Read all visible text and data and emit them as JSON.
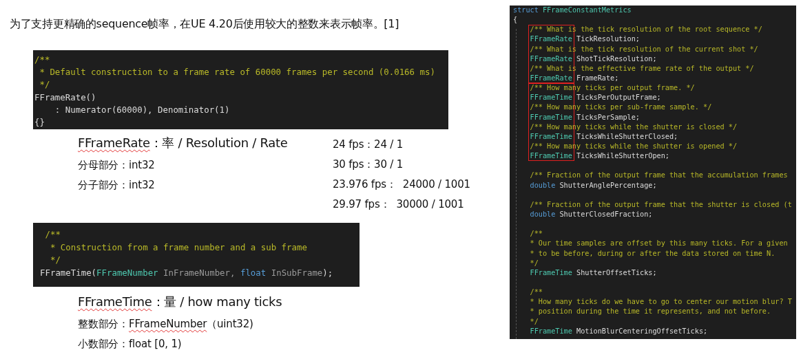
{
  "intro": "为了支持更精确的sequence帧率，在UE 4.20后使用较大的整数来表示帧率。[1]",
  "code_block_1": [
    [
      {
        "kind": "comment",
        "text": "/**"
      }
    ],
    [
      {
        "kind": "comment",
        "text": " * Default construction to a frame rate of 60000 frames per second (0.0166 ms)"
      }
    ],
    [
      {
        "kind": "comment",
        "text": " */"
      }
    ],
    [
      {
        "kind": "plain",
        "text": "FFrameRate()"
      }
    ],
    [
      {
        "kind": "plain",
        "text": "    : Numerator(60000), Denominator(1)"
      }
    ],
    [
      {
        "kind": "plain",
        "text": "{}"
      }
    ]
  ],
  "frame_rate": {
    "heading": [
      {
        "text": "FFrameRate",
        "misspelled": true
      },
      {
        "text": "：率 / Resolution / Rate",
        "misspelled": false
      }
    ],
    "details": [
      "分母部分：int32",
      "分子部分：int32"
    ]
  },
  "fps_examples": [
    "24 fps：24 / 1",
    "30 fps：30 / 1",
    "23.976 fps：  24000 / 1001",
    "29.97 fps：  30000 / 1001"
  ],
  "code_block_2": [
    [
      {
        "kind": "comment",
        "text": " /**"
      }
    ],
    [
      {
        "kind": "comment",
        "text": "  * Construction from a frame number and a sub frame"
      }
    ],
    [
      {
        "kind": "comment",
        "text": "  */"
      }
    ],
    [
      {
        "kind": "plain",
        "text": "FFrameTime("
      },
      {
        "kind": "type",
        "text": "FFrameNumber"
      },
      {
        "kind": "param",
        "text": " InFrameNumber, "
      },
      {
        "kind": "keyword",
        "text": "float"
      },
      {
        "kind": "param",
        "text": " InSubFrame"
      },
      {
        "kind": "plain",
        "text": ");"
      }
    ]
  ],
  "frame_time": {
    "heading": [
      {
        "text": "FFrameTime",
        "misspelled": true
      },
      {
        "text": "：量 / how many ticks",
        "misspelled": false
      }
    ],
    "details": [
      [
        {
          "text": "整数部分：",
          "misspelled": false
        },
        {
          "text": "FFrameNumber",
          "misspelled": true
        },
        {
          "text": "（uint32)",
          "misspelled": false
        }
      ],
      [
        {
          "text": "小数部分：float [0, 1)",
          "misspelled": false
        }
      ]
    ]
  },
  "struct_code": {
    "head": [
      [
        {
          "kind": "keyword",
          "text": "struct"
        },
        {
          "kind": "type",
          "text": " FFrameConstantMetrics"
        }
      ],
      [
        {
          "kind": "plain",
          "text": "{"
        }
      ]
    ],
    "boxed_groups": [
      [
        [
          {
            "kind": "comment",
            "text": "/** What is the tick resolution of the root sequence */"
          }
        ],
        [
          {
            "kind": "type",
            "text": "FFrameRate"
          },
          {
            "kind": "plain",
            "text": "TickResolution;"
          }
        ],
        [
          {
            "kind": "comment",
            "text": "/** What is the tick resolution of the current shot */"
          }
        ],
        [
          {
            "kind": "type",
            "text": "FFrameRate"
          },
          {
            "kind": "plain",
            "text": "ShotTickResolution;"
          }
        ],
        [
          {
            "kind": "comment",
            "text": "/** What is the effective frame rate of the output */"
          }
        ],
        [
          {
            "kind": "type",
            "text": "FFrameRate"
          },
          {
            "kind": "plain",
            "text": "FrameRate;"
          }
        ]
      ],
      [
        [
          {
            "kind": "comment",
            "text": "/** How many ticks per output frame. */"
          }
        ],
        [
          {
            "kind": "type",
            "text": "FFrameTime"
          },
          {
            "kind": "plain",
            "text": "TicksPerOutputFrame;"
          }
        ],
        [
          {
            "kind": "comment",
            "text": "/** How many ticks per sub-frame sample. */"
          }
        ],
        [
          {
            "kind": "type",
            "text": "FFrameTime"
          },
          {
            "kind": "plain",
            "text": "TicksPerSample;"
          }
        ],
        [
          {
            "kind": "comment",
            "text": "/** How many ticks while the shutter is closed */"
          }
        ],
        [
          {
            "kind": "type",
            "text": "FFrameTime"
          },
          {
            "kind": "plain",
            "text": "TicksWhileShutterClosed;"
          }
        ],
        [
          {
            "kind": "comment",
            "text": "/** How many ticks while the shutter is opened */"
          }
        ],
        [
          {
            "kind": "type",
            "text": "FFrameTime"
          },
          {
            "kind": "plain",
            "text": "TicksWhileShutterOpen;"
          }
        ]
      ]
    ],
    "tail": [
      [
        {
          "kind": "blank"
        }
      ],
      [
        {
          "kind": "comment",
          "text": "    /** Fraction of the output frame that the accumulation frames"
        }
      ],
      [
        {
          "kind": "keyword",
          "text": "    double"
        },
        {
          "kind": "plain",
          "text": " ShutterAnglePercentage;"
        }
      ],
      [
        {
          "kind": "blank"
        }
      ],
      [
        {
          "kind": "comment",
          "text": "    /** Fraction of the output frame that the shutter is closed (t"
        }
      ],
      [
        {
          "kind": "keyword",
          "text": "    double"
        },
        {
          "kind": "plain",
          "text": " ShutterClosedFraction;"
        }
      ],
      [
        {
          "kind": "blank"
        }
      ],
      [
        {
          "kind": "comment",
          "text": "    /**"
        }
      ],
      [
        {
          "kind": "comment",
          "text": "    * Our time samples are offset by this many ticks. For a given"
        }
      ],
      [
        {
          "kind": "comment",
          "text": "    * to be before, during or after the data stored on time N."
        }
      ],
      [
        {
          "kind": "comment",
          "text": "    */"
        }
      ],
      [
        {
          "kind": "type",
          "text": "    FFrameTime"
        },
        {
          "kind": "plain",
          "text": " ShutterOffsetTicks;"
        }
      ],
      [
        {
          "kind": "blank"
        }
      ],
      [
        {
          "kind": "comment",
          "text": "    /**"
        }
      ],
      [
        {
          "kind": "comment",
          "text": "    * How many ticks do we have to go to center our motion blur? T"
        }
      ],
      [
        {
          "kind": "comment",
          "text": "    * position during the time it represents, and not before."
        }
      ],
      [
        {
          "kind": "comment",
          "text": "    */"
        }
      ],
      [
        {
          "kind": "type",
          "text": "    FFrameTime"
        },
        {
          "kind": "plain",
          "text": " MotionBlurCenteringOffsetTicks;"
        }
      ]
    ]
  }
}
